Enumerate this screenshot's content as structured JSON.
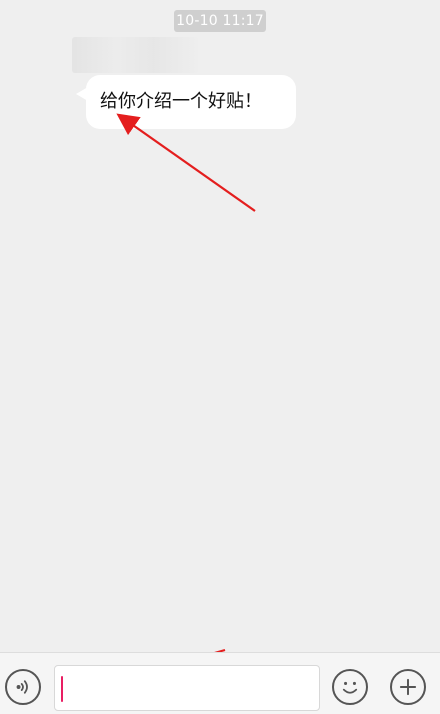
{
  "conversation": {
    "timestamp": "10-10 11:17",
    "message": {
      "text": "给你介绍一个好贴！"
    }
  },
  "composer": {
    "input_value": "",
    "input_placeholder": ""
  },
  "icons": {
    "voice": "voice-icon",
    "emoji": "emoji-icon",
    "plus": "plus-icon"
  },
  "colors": {
    "chat_background": "#efefef",
    "bubble_background": "#ffffff",
    "timestamp_background": "#cfcfcf",
    "input_bar_background": "#f5f5f5",
    "icon_stroke": "#555555",
    "annotation_arrow": "#e41e1e",
    "cursor": "#e91e63"
  }
}
